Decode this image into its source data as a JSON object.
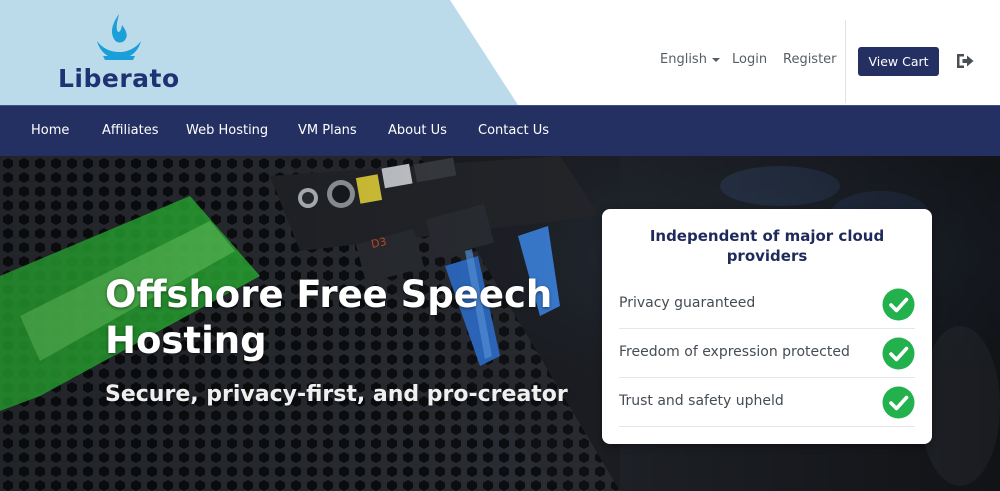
{
  "header": {
    "logo_text": "Liberato",
    "language_label": "English",
    "login_label": "Login",
    "register_label": "Register",
    "view_cart_label": "View Cart"
  },
  "nav": {
    "items": [
      {
        "label": "Home"
      },
      {
        "label": "Affiliates"
      },
      {
        "label": "Web Hosting"
      },
      {
        "label": "VM Plans"
      },
      {
        "label": "About Us"
      },
      {
        "label": "Contact Us"
      }
    ]
  },
  "hero": {
    "title": "Offshore Free Speech Hosting",
    "subtitle": "Secure, privacy-first, and pro-creator"
  },
  "card": {
    "title": "Independent of major cloud providers",
    "features": [
      {
        "label": "Privacy guaranteed",
        "icon": "check-circle-icon"
      },
      {
        "label": "Freedom of expression protected",
        "icon": "check-circle-icon"
      },
      {
        "label": "Trust and safety upheld",
        "icon": "check-circle-icon"
      }
    ]
  },
  "colors": {
    "brand_navy": "#253062",
    "logo_panel": "#bcdbea",
    "flame_blue": "#1a9fd9",
    "check_green": "#22b14c"
  }
}
